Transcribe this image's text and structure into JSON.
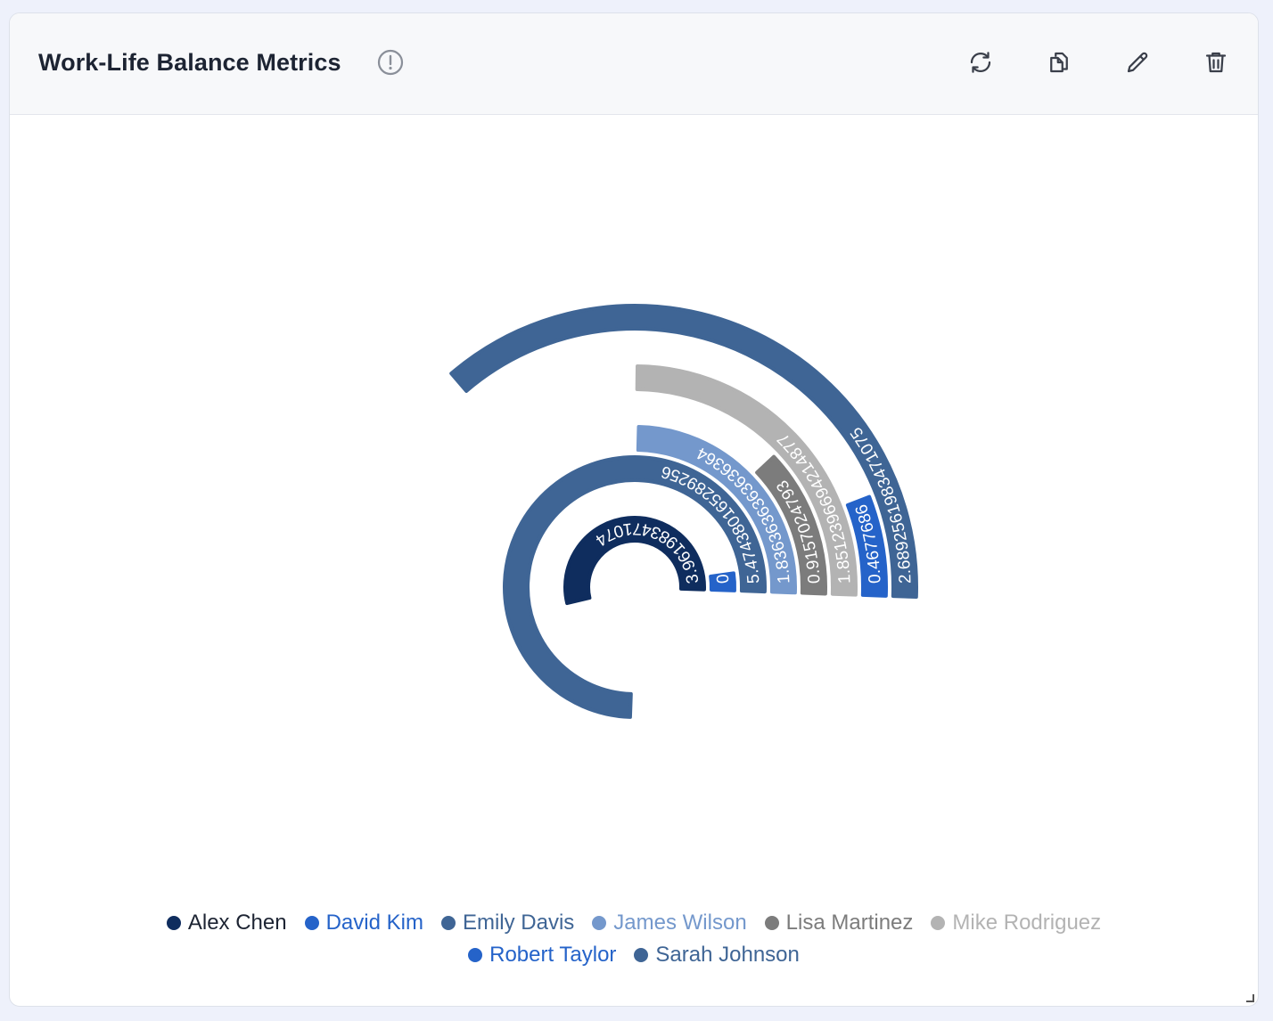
{
  "header": {
    "title": "Work-Life Balance Metrics",
    "info_icon": "alert-circle-icon",
    "toolbar": [
      {
        "name": "refresh-button",
        "icon": "refresh-icon"
      },
      {
        "name": "copy-button",
        "icon": "copy-icon"
      },
      {
        "name": "edit-button",
        "icon": "pencil-icon"
      },
      {
        "name": "delete-button",
        "icon": "trash-icon"
      }
    ]
  },
  "chart_data": {
    "type": "radial-bar",
    "title": "",
    "series": [
      {
        "name": "Alex Chen",
        "value": 3.961983471074,
        "label": "3.961983471074",
        "color": "#0f2d5e"
      },
      {
        "name": "David Kim",
        "value": 0.0,
        "label": "0.0",
        "color": "#2563c9"
      },
      {
        "name": "Emily Davis",
        "value": 5.474380165289256,
        "label": "5.474380165289256",
        "color": "#3f6595"
      },
      {
        "name": "James Wilson",
        "value": 1.8363636363636364,
        "label": "1.8363636363636364",
        "color": "#7498cc"
      },
      {
        "name": "Lisa Martinez",
        "value": 0.9157024793,
        "label": "0.9157024793",
        "color": "#7c7c7c"
      },
      {
        "name": "Mike Rodriguez",
        "value": 1.8512396694214877,
        "label": "1.8512396694214877",
        "color": "#b3b3b3"
      },
      {
        "name": "Robert Taylor",
        "value": 0.4677686,
        "label": "0.4677686",
        "color": "#2563c9"
      },
      {
        "name": "Sarah Johnson",
        "value": 2.6892561983471075,
        "label": "2.6892561983471075",
        "color": "#3f6595"
      }
    ],
    "legend_position": "bottom"
  },
  "legend": {
    "rows": [
      [
        0,
        1,
        2,
        3,
        4,
        5
      ],
      [
        6,
        7
      ]
    ]
  }
}
